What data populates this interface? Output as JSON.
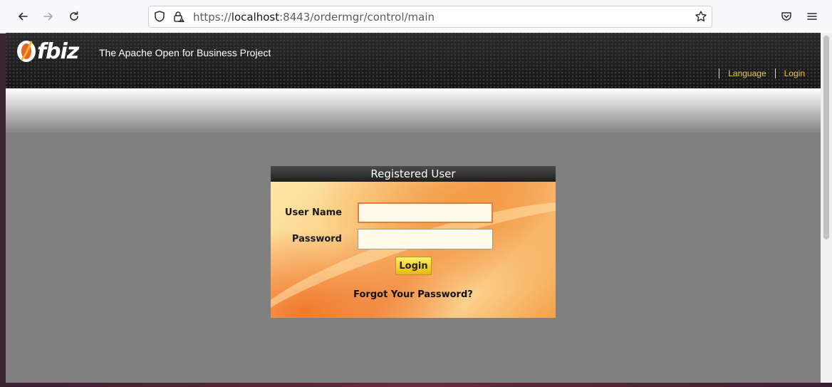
{
  "browser": {
    "url_prefix": "https://",
    "url_host": "localhost",
    "url_rest": ":8443/ordermgr/control/main",
    "icons": {
      "back": "arrow-left-icon",
      "forward": "arrow-right-icon",
      "reload": "reload-icon",
      "tracking": "shield-icon",
      "security": "lock-warning-icon",
      "bookmark": "star-icon",
      "pocket": "pocket-icon",
      "menu": "hamburger-menu-icon"
    }
  },
  "header": {
    "logo_text": "fbiz",
    "tagline": "The Apache Open for Business Project",
    "links": [
      "Language",
      "Login"
    ]
  },
  "login": {
    "title": "Registered User",
    "username_label": "User Name",
    "password_label": "Password",
    "username_value": "",
    "password_value": "",
    "submit_label": "Login",
    "forgot_label": "Forgot Your Password?"
  },
  "colors": {
    "header_bg": "#1e1e1e",
    "link": "#e8c547",
    "page_bg": "#808080",
    "button": "#f0cf2a",
    "input_focus": "#e07f3e"
  }
}
